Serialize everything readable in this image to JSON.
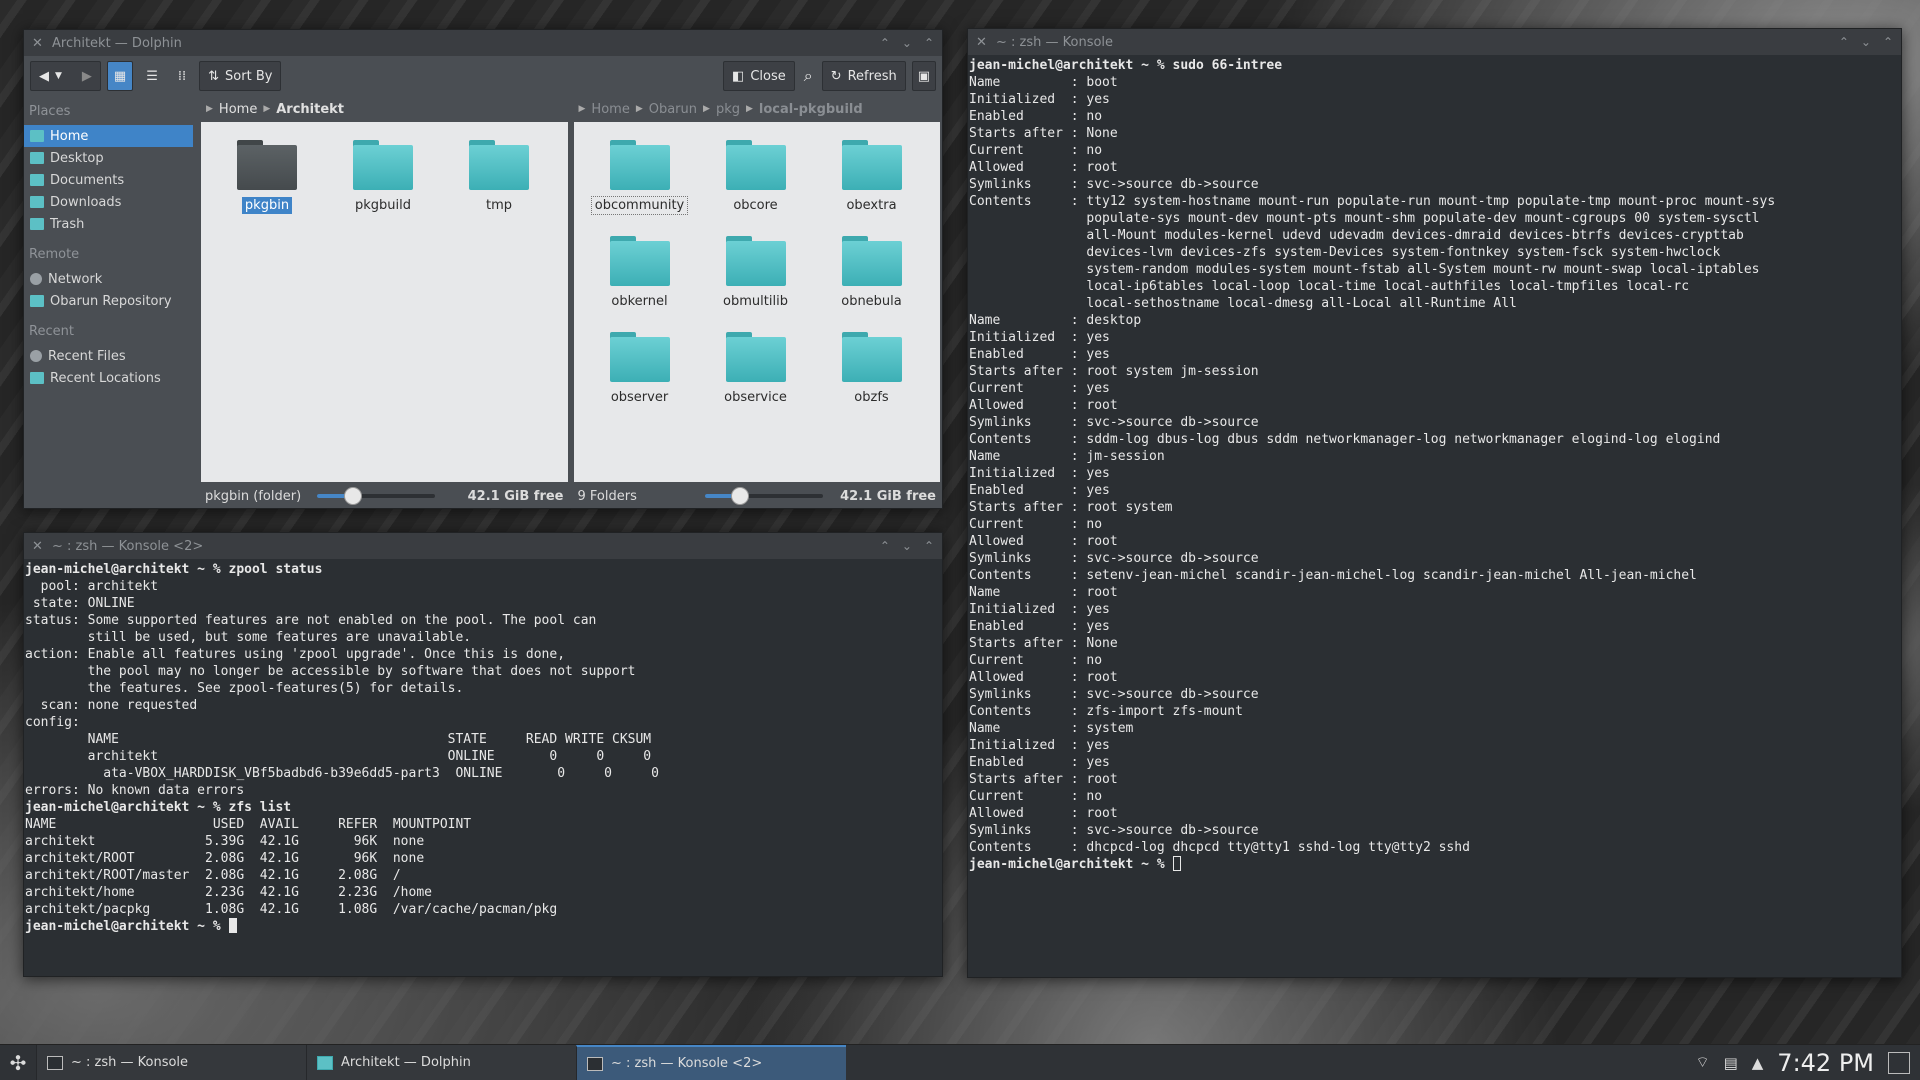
{
  "dolphin": {
    "title": "Architekt — Dolphin",
    "toolbar": {
      "sort_label": "Sort By",
      "close_label": "Close",
      "refresh_label": "Refresh"
    },
    "places": {
      "section_places": "Places",
      "items": [
        "Home",
        "Desktop",
        "Documents",
        "Downloads",
        "Trash"
      ],
      "section_remote": "Remote",
      "remote_items": [
        "Network",
        "Obarun Repository"
      ],
      "section_recent": "Recent",
      "recent_items": [
        "Recent Files",
        "Recent Locations"
      ]
    },
    "left_pane": {
      "crumbs": [
        "Home",
        "Architekt"
      ],
      "folders": [
        "pkgbin",
        "pkgbuild",
        "tmp"
      ],
      "status": "pkgbin (folder)",
      "zoom_fraction": 0.3,
      "free": "42.1 GiB free"
    },
    "right_pane": {
      "crumbs": [
        "Home",
        "Obarun",
        "pkg",
        "local-pkgbuild"
      ],
      "folders": [
        "obcommunity",
        "obcore",
        "obextra",
        "obkernel",
        "obmultilib",
        "obnebula",
        "observer",
        "observice",
        "obzfs"
      ],
      "status": "9 Folders",
      "zoom_fraction": 0.3,
      "free": "42.1 GiB free"
    }
  },
  "konsole2": {
    "title": "~ : zsh — Konsole <2>",
    "lines": [
      "jean-michel@architekt ~ % zpool status",
      "  pool: architekt",
      " state: ONLINE",
      "status: Some supported features are not enabled on the pool. The pool can",
      "        still be used, but some features are unavailable.",
      "action: Enable all features using 'zpool upgrade'. Once this is done,",
      "        the pool may no longer be accessible by software that does not support",
      "        the features. See zpool-features(5) for details.",
      "  scan: none requested",
      "config:",
      "",
      "        NAME                                          STATE     READ WRITE CKSUM",
      "        architekt                                     ONLINE       0     0     0",
      "          ata-VBOX_HARDDISK_VBf5badbd6-b39e6dd5-part3  ONLINE       0     0     0",
      "",
      "errors: No known data errors",
      "jean-michel@architekt ~ % zfs list",
      "NAME                    USED  AVAIL     REFER  MOUNTPOINT",
      "architekt              5.39G  42.1G       96K  none",
      "architekt/ROOT         2.08G  42.1G       96K  none",
      "architekt/ROOT/master  2.08G  42.1G     2.08G  /",
      "architekt/home         2.23G  42.1G     2.23G  /home",
      "architekt/pacpkg       1.08G  42.1G     1.08G  /var/cache/pacman/pkg",
      "jean-michel@architekt ~ % "
    ]
  },
  "konsole1": {
    "title": "~ : zsh — Konsole",
    "lines": [
      "jean-michel@architekt ~ % sudo 66-intree",
      "Name         : boot",
      "Initialized  : yes",
      "Enabled      : no",
      "Starts after : None",
      "Current      : no",
      "Allowed      : root",
      "Symlinks     : svc->source db->source",
      "Contents     : tty12 system-hostname mount-run populate-run mount-tmp populate-tmp mount-proc mount-sys",
      "               populate-sys mount-dev mount-pts mount-shm populate-dev mount-cgroups 00 system-sysctl",
      "               all-Mount modules-kernel udevd udevadm devices-dmraid devices-btrfs devices-crypttab",
      "               devices-lvm devices-zfs system-Devices system-fontnkey system-fsck system-hwclock",
      "               system-random modules-system mount-fstab all-System mount-rw mount-swap local-iptables",
      "               local-ip6tables local-loop local-time local-authfiles local-tmpfiles local-rc",
      "               local-sethostname local-dmesg all-Local all-Runtime All",
      "",
      "Name         : desktop",
      "Initialized  : yes",
      "Enabled      : yes",
      "Starts after : root system jm-session",
      "Current      : yes",
      "Allowed      : root",
      "Symlinks     : svc->source db->source",
      "Contents     : sddm-log dbus-log dbus sddm networkmanager-log networkmanager elogind-log elogind",
      "",
      "Name         : jm-session",
      "Initialized  : yes",
      "Enabled      : yes",
      "Starts after : root system",
      "Current      : no",
      "Allowed      : root",
      "Symlinks     : svc->source db->source",
      "Contents     : setenv-jean-michel scandir-jean-michel-log scandir-jean-michel All-jean-michel",
      "",
      "Name         : root",
      "Initialized  : yes",
      "Enabled      : yes",
      "Starts after : None",
      "Current      : no",
      "Allowed      : root",
      "Symlinks     : svc->source db->source",
      "Contents     : zfs-import zfs-mount",
      "",
      "Name         : system",
      "Initialized  : yes",
      "Enabled      : yes",
      "Starts after : root",
      "Current      : no",
      "Allowed      : root",
      "Symlinks     : svc->source db->source",
      "Contents     : dhcpcd-log dhcpcd tty@tty1 sshd-log tty@tty2 sshd",
      "",
      "jean-michel@architekt ~ % "
    ]
  },
  "taskbar": {
    "tasks": [
      "~ : zsh — Konsole",
      "Architekt — Dolphin",
      "~ : zsh — Konsole <2>"
    ],
    "clock": "7:42 PM"
  },
  "icons": [
    "back-icon",
    "forward-icon",
    "icons-view-icon",
    "details-view-icon",
    "compact-view-icon",
    "sort-icon",
    "close-split-icon",
    "search-icon",
    "refresh-icon",
    "terminal-icon",
    "folder-icon",
    "launcher-icon",
    "network-tray-icon",
    "clipboard-tray-icon",
    "tray-expand-icon",
    "show-desktop-icon"
  ],
  "colors": {
    "accent": "#3f84c8",
    "folder": "#4fc1c7",
    "terminal_bg": "#2b2f33",
    "window_bg": "#4a4e53"
  }
}
